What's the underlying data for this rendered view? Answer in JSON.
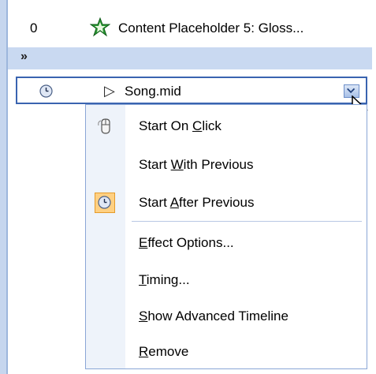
{
  "list": {
    "row0": {
      "order": "0",
      "icon": "emphasis-star-icon",
      "name": "Content Placeholder 5: Gloss..."
    },
    "collapse_icon": "double-chevron-down-icon",
    "selected_item": {
      "timing_icon": "clock-icon",
      "type_icon": "play-triangle-icon",
      "name": "Song.mid",
      "dropdown_icon": "chevron-down-icon"
    }
  },
  "menu": {
    "items": [
      {
        "pre": "Start On ",
        "key": "C",
        "post": "lick",
        "icon": "mouse-icon",
        "checked": false
      },
      {
        "pre": "Start ",
        "key": "W",
        "post": "ith Previous",
        "icon": "",
        "checked": false
      },
      {
        "pre": "Start ",
        "key": "A",
        "post": "fter Previous",
        "icon": "clock-icon",
        "checked": true
      },
      {
        "pre": "",
        "key": "E",
        "post": "ffect Options...",
        "icon": "",
        "checked": false
      },
      {
        "pre": "",
        "key": "T",
        "post": "iming...",
        "icon": "",
        "checked": false
      },
      {
        "pre": "",
        "key": "S",
        "post": "how Advanced Timeline",
        "icon": "",
        "checked": false
      },
      {
        "pre": "",
        "key": "R",
        "post": "emove",
        "icon": "",
        "checked": false
      }
    ]
  },
  "colors": {
    "selection_border": "#3a64b0",
    "band": "#c9d9f1",
    "checked_bg": "#ffd082",
    "menu_border": "#8aa6d6"
  }
}
